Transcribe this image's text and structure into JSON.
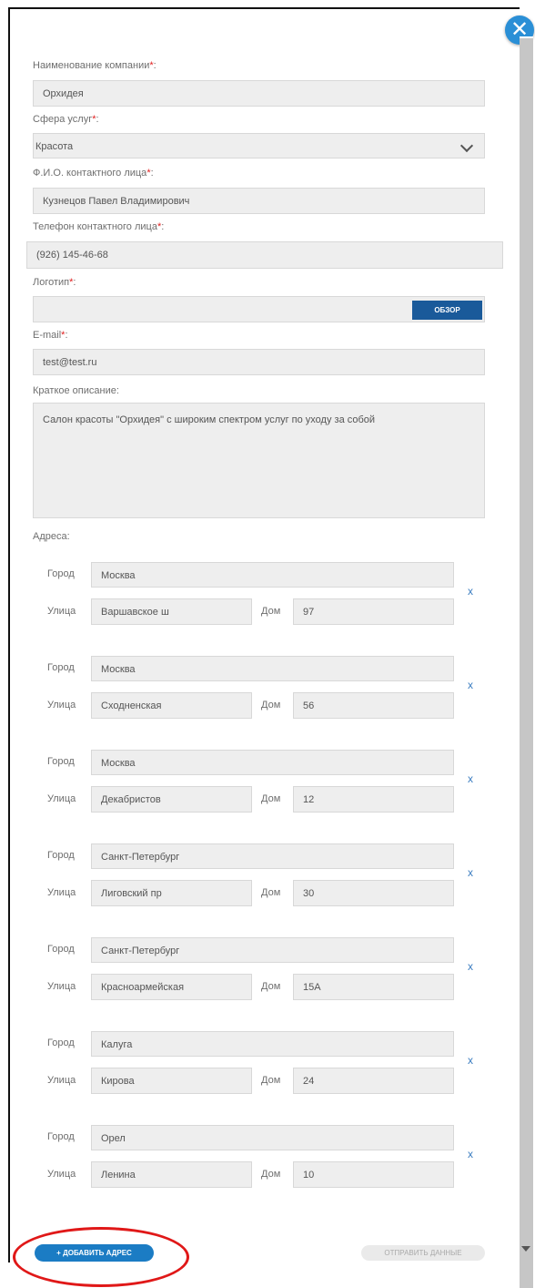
{
  "form": {
    "company_label": "Наименование компании",
    "company_value": "Орхидея",
    "sphere_label": "Сфера услуг",
    "sphere_value": "Красота",
    "contact_label": "Ф.И.О. контактного лица",
    "contact_value": "Кузнецов Павел Владимирович",
    "phone_label": "Телефон контактного лица",
    "phone_value": "(926) 145-46-68",
    "logo_label": "Логотип",
    "browse_label": "ОБЗОР",
    "email_label": "E-mail",
    "email_value": "test@test.ru",
    "desc_label": "Краткое описание:",
    "desc_value": "Салон красоты \"Орхидея\" с широким спектром услуг по уходу за собой",
    "required_mark": "*",
    "colon": ":"
  },
  "addresses_title": "Адреса:",
  "address_labels": {
    "city": "Город",
    "street": "Улица",
    "house": "Дом",
    "remove": "x"
  },
  "addresses": [
    {
      "city": "Москва",
      "street": "Варшавское ш",
      "house": "97"
    },
    {
      "city": "Москва",
      "street": "Сходненская",
      "house": "56"
    },
    {
      "city": "Москва",
      "street": "Декабристов",
      "house": "12"
    },
    {
      "city": "Санкт-Петербург",
      "street": "Лиговский пр",
      "house": "30"
    },
    {
      "city": "Санкт-Петербург",
      "street": "Красноармейская",
      "house": "15А"
    },
    {
      "city": "Калуга",
      "street": "Кирова",
      "house": "24"
    },
    {
      "city": "Орел",
      "street": "Ленина",
      "house": "10"
    }
  ],
  "buttons": {
    "add_address": "+ ДОБАВИТЬ АДРЕС",
    "submit": "ОТПРАВИТЬ ДАННЫЕ",
    "close": "✕"
  },
  "colors": {
    "accent": "#1b7cc4",
    "required": "#e02020",
    "annotation": "#e01818"
  }
}
